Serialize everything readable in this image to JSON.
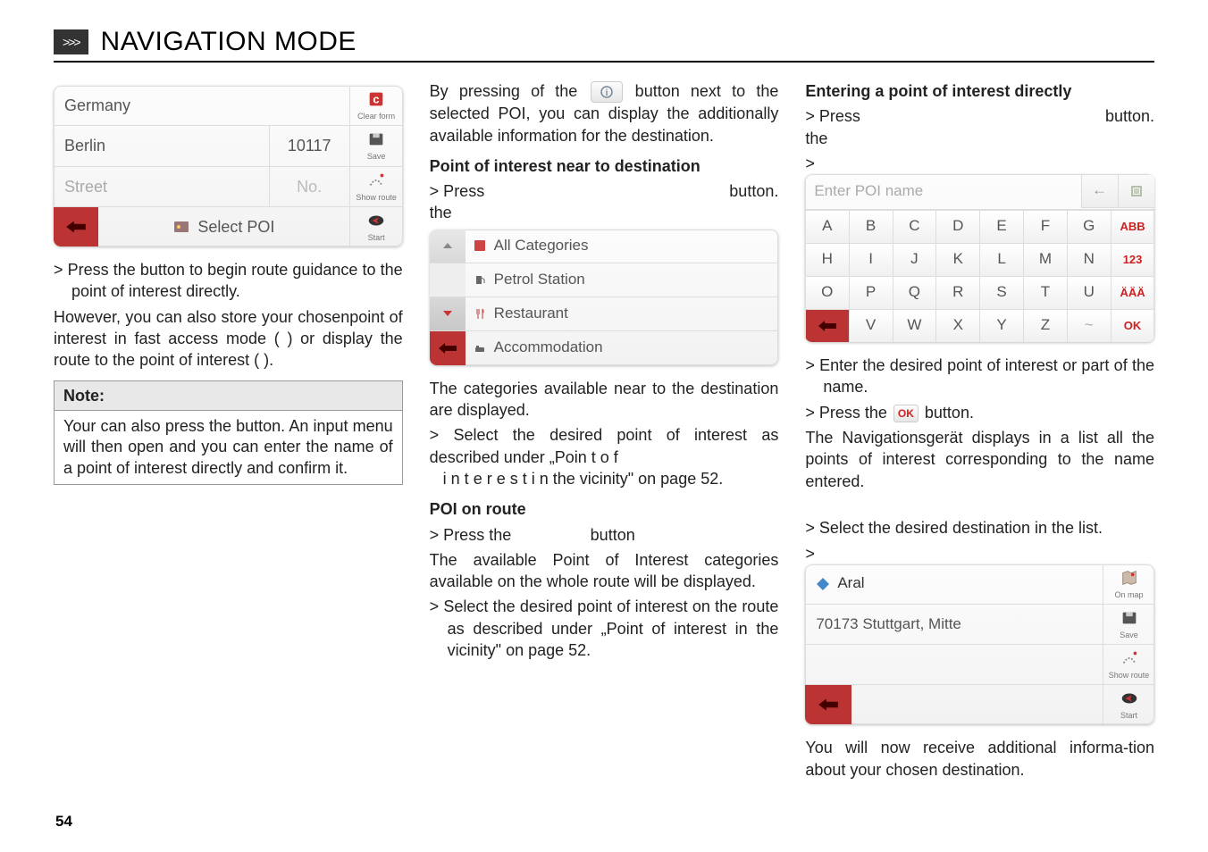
{
  "header": {
    "arrow": ">>>",
    "title": "NAVIGATION MODE"
  },
  "col1": {
    "address": {
      "country": "Germany",
      "city": "Berlin",
      "postal": "10117",
      "street": "Street",
      "no": "No.",
      "select_poi": "Select POI",
      "btn_clear": "Clear form",
      "btn_save": "Save",
      "btn_showroute": "Show route",
      "btn_start": "Start"
    },
    "p1a": "> Press the ",
    "p1b": " button to begin route guidance to the point of interest directly.",
    "p2": "However, you can also store your chosenpoint of interest in fast access mode (        ) or display the route to the point of interest (                    ).",
    "note_head": "Note:",
    "note_body": "Your can also press the                 button. An input menu will then open and you can enter the name of a point of interest directly and confirm it."
  },
  "col2": {
    "p1": "By pressing of the        button next to the selected POI, you can display the additionally available information for the destination.",
    "h1": "Point of interest near to destination",
    "p2a": "> Press the",
    "p2b": "button.",
    "cats": [
      "All Categories",
      "Petrol Station",
      "Restaurant",
      "Accommodation"
    ],
    "p3": "The categories available near to the destination are displayed.",
    "p4": "> Select the desired point of interest as described under „Point of interest in  the vicinity\" on page 52.",
    "h2": "POI on route",
    "p5a": "> Press the",
    "p5b": "button",
    "p6": "The available Point of Interest categories available on the whole route will be displayed.",
    "p7": "> Select the desired point of interest on the route as described under „Point of interest in the vicinity\" on page 52."
  },
  "col3": {
    "h1": "Entering a point of interest directly",
    "p1a": "> Press the",
    "p1b": "button.",
    "p1c": ">",
    "kb": {
      "placeholder": "Enter POI name",
      "rows": [
        [
          "A",
          "B",
          "C",
          "D",
          "E",
          "F",
          "G"
        ],
        [
          "H",
          "I",
          "J",
          "K",
          "L",
          "M",
          "N"
        ],
        [
          "O",
          "P",
          "Q",
          "R",
          "S",
          "T",
          "U"
        ],
        [
          "",
          "V",
          "W",
          "X",
          "Y",
          "Z",
          "~"
        ]
      ],
      "side": [
        "ABB",
        "123",
        "ÄÄÄ",
        "OK"
      ]
    },
    "p2": "> Enter the desired point of interest or part of the name.",
    "p3a": "> Press the ",
    "p3b": " button.",
    "p4": "The Navigationsgerät displays in a list all the points of interest corresponding to the name entered.",
    "p5": "> Select the desired destination in the list.",
    "p5b": ">",
    "dest": {
      "name": "Aral",
      "addr": "70173 Stuttgart, Mitte",
      "btn_onmap": "On map",
      "btn_save": "Save",
      "btn_showroute": "Show route",
      "btn_start": "Start"
    },
    "p6": "You will now receive additional informa-tion about your chosen destination."
  },
  "pagenum": "54"
}
